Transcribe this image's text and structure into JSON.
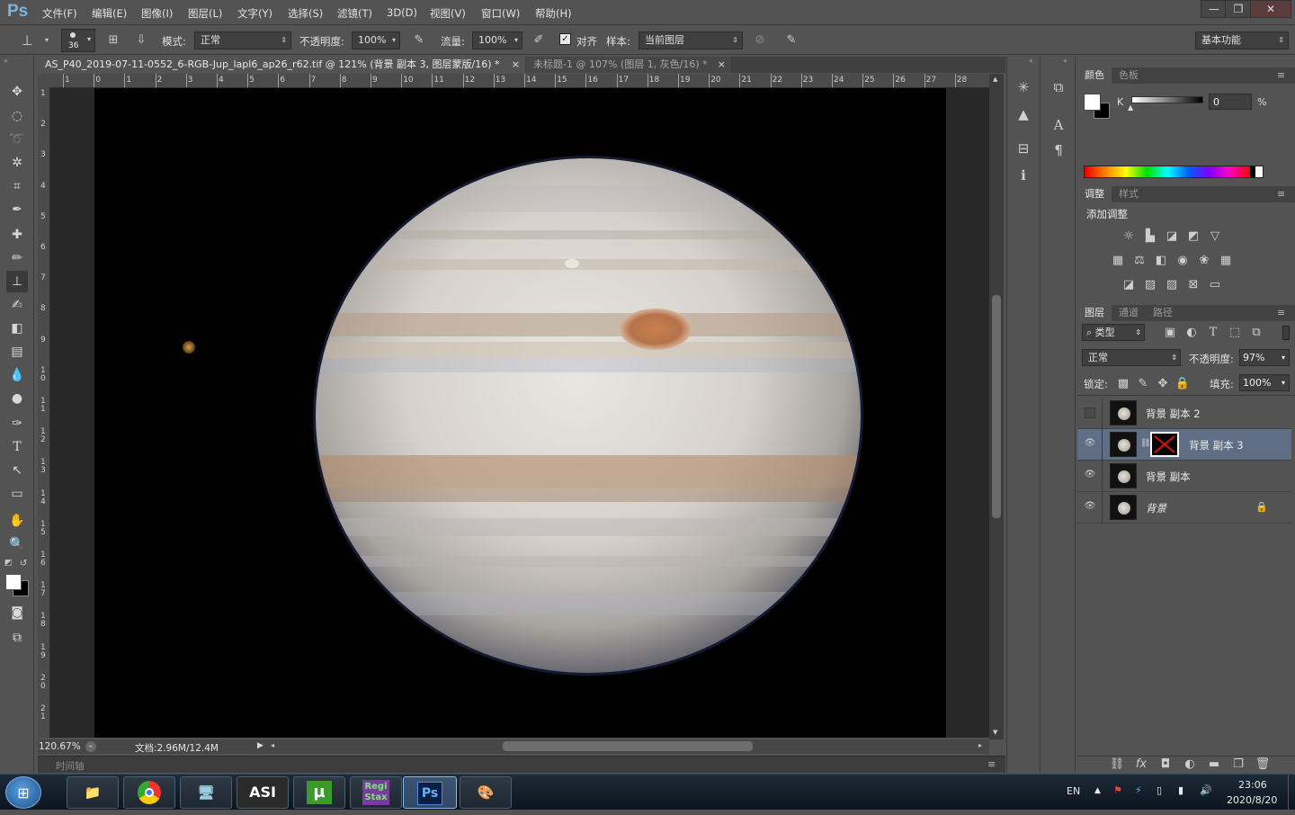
{
  "app": {
    "logo": "Ps"
  },
  "menu": [
    "文件(F)",
    "编辑(E)",
    "图像(I)",
    "图层(L)",
    "文字(Y)",
    "选择(S)",
    "滤镜(T)",
    "3D(D)",
    "视图(V)",
    "窗口(W)",
    "帮助(H)"
  ],
  "window_controls": {
    "minimize": "—",
    "restore": "❐",
    "close": "✕"
  },
  "options": {
    "brush_size": "36",
    "mode_label": "模式:",
    "mode_value": "正常",
    "opacity_label": "不透明度:",
    "opacity_value": "100%",
    "flow_label": "流量:",
    "flow_value": "100%",
    "aligned_label": "对齐",
    "sample_label": "样本:",
    "sample_value": "当前图层",
    "workspace": "基本功能"
  },
  "tabs": [
    {
      "title": "AS_P40_2019-07-11-0552_6-RGB-Jup_lapl6_ap26_r62.tif @ 121% (背景 副本 3, 图层蒙版/16) *",
      "close": "×"
    },
    {
      "title": "未标题-1 @ 107% (图层 1, 灰色/16) *",
      "close": "×"
    }
  ],
  "ruler_top": [
    "1",
    "0",
    "1",
    "2",
    "3",
    "4",
    "5",
    "6",
    "7",
    "8",
    "9",
    "10",
    "11",
    "12",
    "13",
    "14",
    "15",
    "16",
    "17",
    "18",
    "19",
    "20",
    "21",
    "22",
    "23",
    "24",
    "25",
    "26",
    "27",
    "28"
  ],
  "ruler_left": [
    "1",
    "2",
    "3",
    "4",
    "5",
    "6",
    "7",
    "8",
    "9",
    "1\n0",
    "1\n1",
    "1\n2",
    "1\n3",
    "1\n4",
    "1\n5",
    "1\n6",
    "1\n7",
    "1\n8",
    "1\n9",
    "2\n0",
    "2\n1"
  ],
  "status": {
    "zoom": "120.67%",
    "doc": "文档:2.96M/12.4M"
  },
  "timeline": {
    "label": "时间轴"
  },
  "color_panel": {
    "tabs": [
      "颜色",
      "色板"
    ],
    "channel": "K",
    "value": "0",
    "unit": "%"
  },
  "adjust_panel": {
    "tabs": [
      "调整",
      "样式"
    ],
    "title": "添加调整"
  },
  "layers_panel": {
    "tabs": [
      "图层",
      "通道",
      "路径"
    ],
    "filter": "类型",
    "blend": "正常",
    "opacity_label": "不透明度:",
    "opacity_value": "97%",
    "lock_label": "锁定:",
    "fill_label": "填充:",
    "fill_value": "100%",
    "layers": [
      {
        "name": "背景 副本 2",
        "visible": false,
        "selected": false
      },
      {
        "name": "背景 副本 3",
        "visible": true,
        "selected": true
      },
      {
        "name": "背景 副本",
        "visible": true,
        "selected": false
      },
      {
        "name": "背景",
        "visible": true,
        "selected": false,
        "locked": true
      }
    ],
    "footer_icons": [
      "link-icon",
      "fx-icon",
      "mask-icon",
      "adjustment-icon",
      "folder-icon",
      "new-layer-icon",
      "trash-icon"
    ]
  },
  "taskbar": {
    "apps": [
      "folder",
      "chrome",
      "monitor",
      "ASI",
      "uTorrent",
      "RegiStax",
      "Ps",
      "paint"
    ],
    "app_labels": {
      "asi": "ASI",
      "utorrent": "µ",
      "registax": "Regi\nStax",
      "ps": "Ps"
    },
    "lang": "EN",
    "time": "23:06",
    "date": "2020/8/20"
  },
  "colors": {
    "accent": "#5f6e85",
    "bg": "#535353",
    "dark": "#3f3f3f"
  }
}
